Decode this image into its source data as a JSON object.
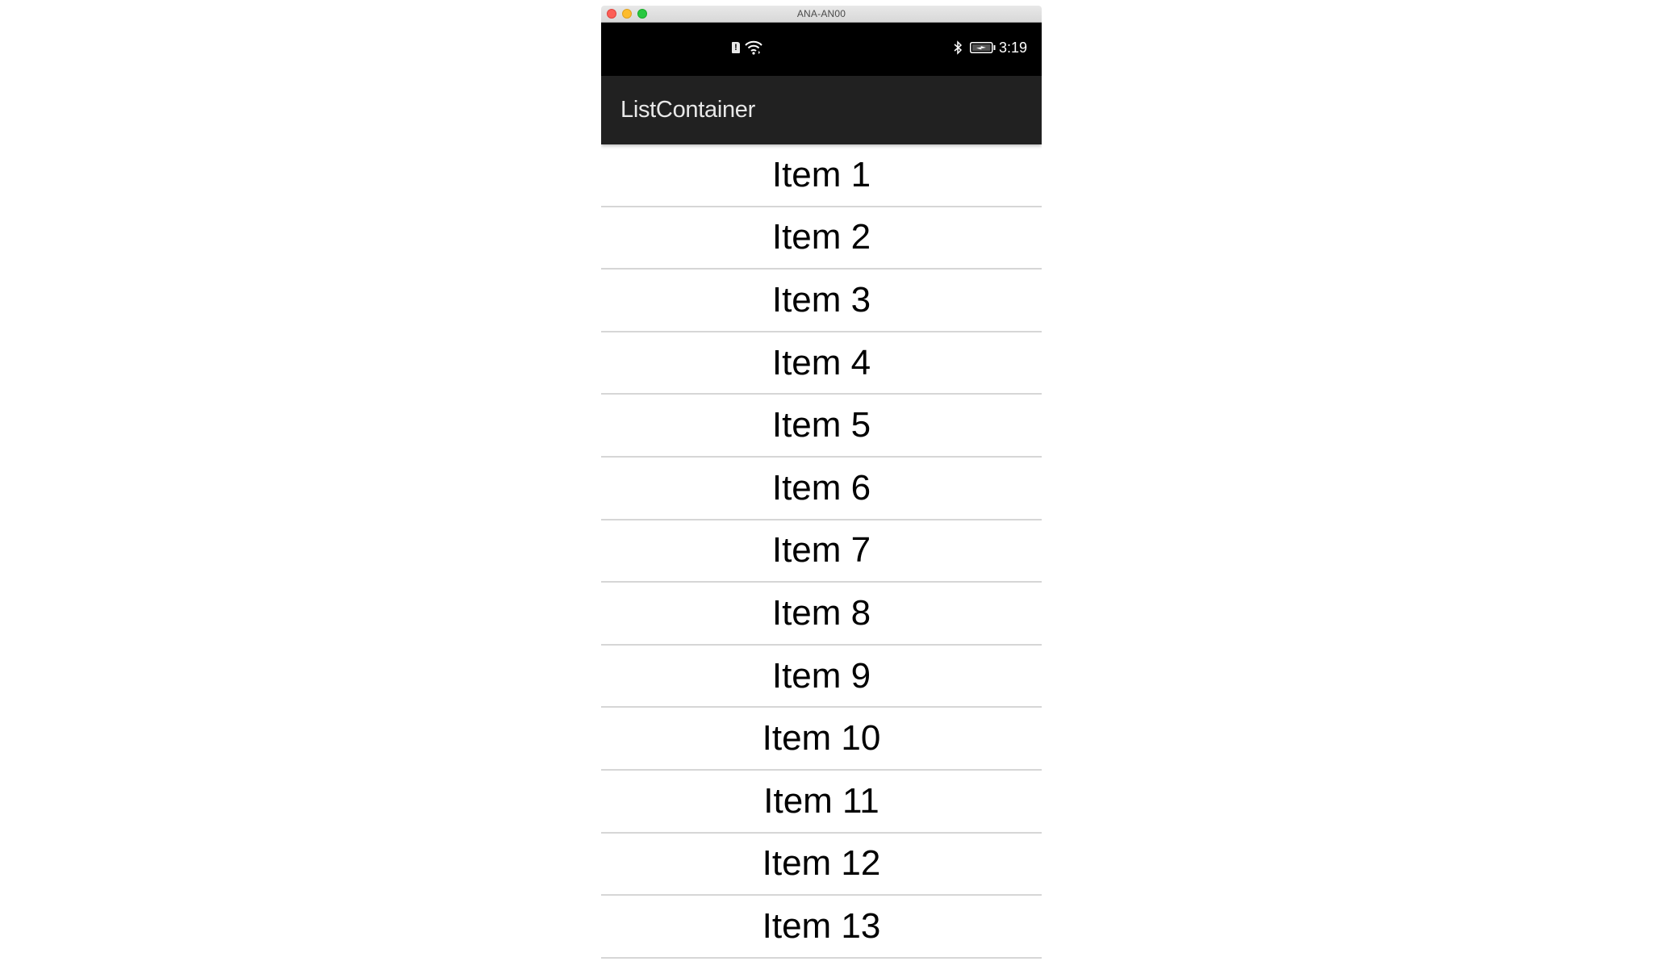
{
  "window": {
    "title": "ANA-AN00",
    "controls": [
      "close",
      "minimize",
      "maximize"
    ]
  },
  "status_bar": {
    "left_icons": [
      "sim-alert-icon",
      "wifi-icon"
    ],
    "sim_alert_glyph": "!",
    "right_icons": [
      "bluetooth-icon",
      "battery-charging-icon"
    ],
    "time": "3:19"
  },
  "toolbar": {
    "title": "ListContainer"
  },
  "colors": {
    "status_bar": "#000000",
    "toolbar": "#212121",
    "toolbar_text": "#e8e8e8",
    "list_background": "#ffffff",
    "divider": "#d6d6d6",
    "item_text": "#000000"
  },
  "list": {
    "items": [
      {
        "label": "Item 1"
      },
      {
        "label": "Item 2"
      },
      {
        "label": "Item 3"
      },
      {
        "label": "Item 4"
      },
      {
        "label": "Item 5"
      },
      {
        "label": "Item 6"
      },
      {
        "label": "Item 7"
      },
      {
        "label": "Item 8"
      },
      {
        "label": "Item 9"
      },
      {
        "label": "Item 10"
      },
      {
        "label": "Item 11"
      },
      {
        "label": "Item 12"
      },
      {
        "label": "Item 13"
      }
    ]
  }
}
